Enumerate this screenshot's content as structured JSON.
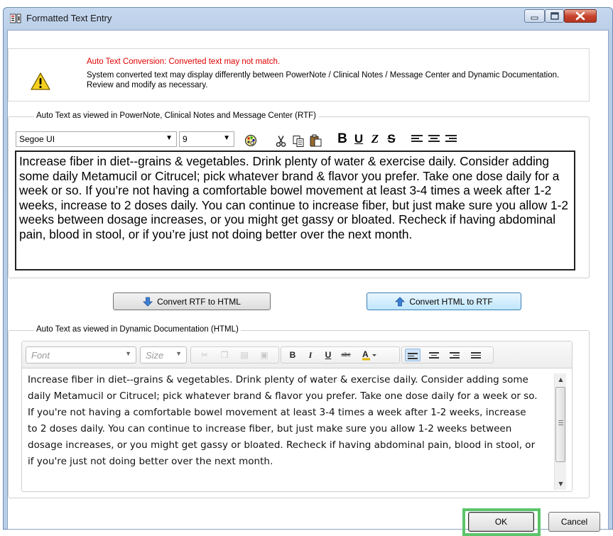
{
  "window": {
    "title": "Formatted Text Entry"
  },
  "warning": {
    "title": "Auto Text Conversion: Converted text may not match.",
    "body": "System converted text may display differently between PowerNote / Clinical Notes / Message Center and Dynamic Documentation. Review and modify as necessary."
  },
  "rtf": {
    "legend": "Auto Text as viewed in PowerNote, Clinical Notes and Message Center (RTF)",
    "font": "Segoe UI",
    "size": "9",
    "text": "Increase fiber in diet--grains & vegetables. Drink plenty of water & exercise daily. Consider adding some daily Metamucil or Citrucel; pick whatever brand & flavor you prefer. Take one dose daily for a week or so. If you’re not having a comfortable bowel movement at least 3-4 times a week after 1-2 weeks, increase to 2 doses daily. You can continue to increase fiber, but just make sure you allow 1-2 weeks between dosage increases, or you might get gassy or bloated. Recheck if having abdominal pain, blood in stool, or if you’re just not doing better over the next month."
  },
  "convert": {
    "to_html": "Convert RTF to HTML",
    "to_rtf": "Convert HTML to RTF"
  },
  "html": {
    "legend": "Auto Text as viewed in Dynamic Documentation (HTML)",
    "font_placeholder": "Font",
    "size_placeholder": "Size",
    "text": "Increase fiber in diet--grains & vegetables. Drink plenty of water & exercise daily. Consider adding some daily Metamucil or Citrucel; pick whatever brand & flavor you prefer. Take one dose daily for a week or so. If you're not having a comfortable bowel movement at least 3-4 times a week after 1-2 weeks, increase to 2 doses daily. You can continue to increase fiber, but just make sure you allow 1-2 weeks between dosage increases, or you might get gassy or bloated. Recheck if having abdominal pain, blood in stool, or if you're just not doing better over the next month."
  },
  "buttons": {
    "ok": "OK",
    "cancel": "Cancel"
  },
  "icons": {
    "rtf_toolbar": [
      "color-palette-icon",
      "cut-icon",
      "copy-icon",
      "paste-icon",
      "bold-icon",
      "underline-icon",
      "italic-icon",
      "strikethrough-icon",
      "align-left-icon",
      "align-center-icon",
      "align-right-icon"
    ],
    "html_toolbar": [
      "cut-icon",
      "copy-icon",
      "paste-text-icon",
      "paste-icon",
      "bold-icon",
      "italic-icon",
      "underline-icon",
      "strikethrough-icon",
      "font-color-icon",
      "align-left-icon",
      "align-center-icon",
      "align-right-icon",
      "justify-icon"
    ]
  },
  "colors": {
    "accent_highlight": "#5cc46a",
    "warning_title": "#e00000"
  }
}
